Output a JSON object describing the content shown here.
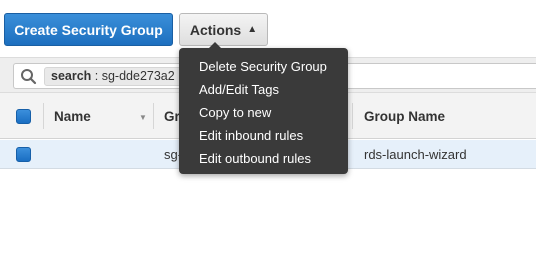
{
  "toolbar": {
    "create_label": "Create Security Group",
    "actions_label": "Actions",
    "actions_caret": "^"
  },
  "filter": {
    "token_key": "search",
    "token_value": " : sg-dde273a2"
  },
  "table": {
    "columns": [
      "Name",
      "Gr",
      "Group Name"
    ],
    "rows": [
      {
        "name": "",
        "group_id": "sg-",
        "group_name": "rds-launch-wizard"
      }
    ]
  },
  "actions_menu": {
    "items": [
      "Delete Security Group",
      "Add/Edit Tags",
      "Copy to new",
      "Edit inbound rules",
      "Edit outbound rules"
    ]
  },
  "colors": {
    "primary_button": "#1d6fbf",
    "menu_background": "#3a3a3a",
    "selected_row": "#e6f0fa"
  }
}
